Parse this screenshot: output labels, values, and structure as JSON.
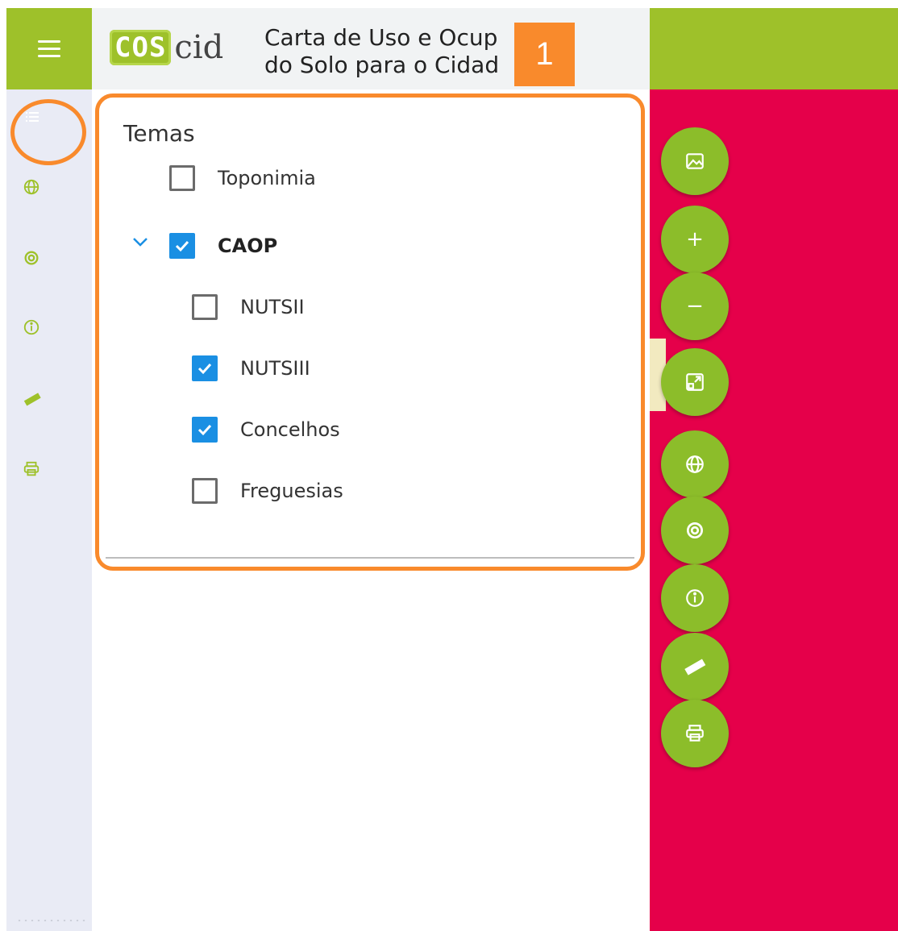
{
  "header": {
    "logo_cos": "COS",
    "logo_cid": "cid",
    "title_line1": "Carta de Uso e Ocup",
    "title_line2": "do Solo para o Cidad",
    "step_badge": "1"
  },
  "left_toolbar": {
    "items": [
      {
        "name": "layers",
        "icon": "list-icon",
        "active": true
      },
      {
        "name": "basemap",
        "icon": "globe-icon",
        "active": false
      },
      {
        "name": "location",
        "icon": "target-icon",
        "active": false
      },
      {
        "name": "info",
        "icon": "info-icon",
        "active": false
      },
      {
        "name": "measure",
        "icon": "ruler-icon",
        "active": false
      },
      {
        "name": "print",
        "icon": "printer-icon",
        "active": false
      }
    ]
  },
  "panel": {
    "title": "Temas",
    "layers": [
      {
        "label": "Toponimia",
        "checked": false
      },
      {
        "label": "CAOP",
        "checked": true,
        "expanded": true
      },
      {
        "label": "NUTSII",
        "checked": false
      },
      {
        "label": "NUTSIII",
        "checked": true
      },
      {
        "label": "Concelhos",
        "checked": true
      },
      {
        "label": "Freguesias",
        "checked": false
      }
    ]
  },
  "map_controls": {
    "buttons": [
      "image-icon",
      "zoom-in-icon",
      "zoom-out-icon",
      "fullscreen-icon",
      "globe-icon",
      "target-icon",
      "info-icon",
      "ruler-icon",
      "printer-icon"
    ],
    "zoom_in": "+",
    "zoom_out": "−"
  },
  "colors": {
    "brand_green": "#9ec12a",
    "accent_orange": "#f98a2c",
    "map_fill": "#e5004a",
    "checkbox_blue": "#1a8fe3"
  }
}
